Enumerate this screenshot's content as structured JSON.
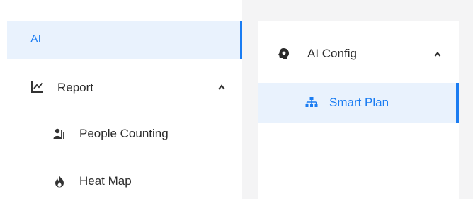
{
  "left_nav": {
    "ai": {
      "label": "AI"
    },
    "report": {
      "label": "Report",
      "icon": "line-chart-icon",
      "expanded": true,
      "children": [
        {
          "label": "People Counting",
          "icon": "people-icon"
        },
        {
          "label": "Heat Map",
          "icon": "flame-icon"
        }
      ]
    }
  },
  "right_panel": {
    "section": {
      "label": "AI Config",
      "icon": "ai-config-icon",
      "expanded": true
    },
    "items": [
      {
        "label": "Smart Plan",
        "icon": "hierarchy-icon"
      }
    ]
  },
  "colors": {
    "accent": "#1a7cf2",
    "selected_bg": "#e9f2fd",
    "text": "#2b2b2b",
    "panel_bg": "#f4f4f5"
  }
}
